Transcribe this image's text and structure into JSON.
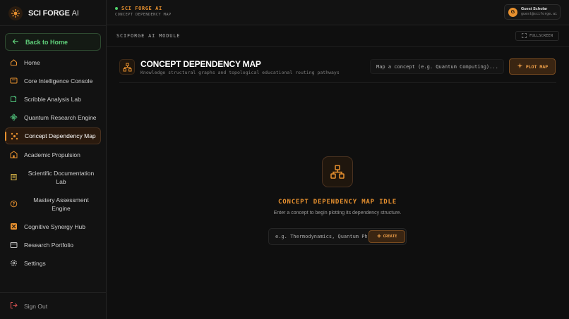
{
  "brand": {
    "name": "SCI FORGE",
    "suffix": "AI"
  },
  "sidebar": {
    "back_label": "Back to Home",
    "items": [
      {
        "label": "Home",
        "icon": "home-icon"
      },
      {
        "label": "Core Intelligence Console",
        "icon": "console-icon"
      },
      {
        "label": "Scribble Analysis Lab",
        "icon": "scribble-icon"
      },
      {
        "label": "Quantum Research Engine",
        "icon": "atom-icon"
      },
      {
        "label": "Concept Dependency Map",
        "icon": "network-icon",
        "active": true
      },
      {
        "label": "Academic Propulsion",
        "icon": "building-icon"
      },
      {
        "label": "Scientific Documentation Lab",
        "icon": "document-icon"
      },
      {
        "label": "Mastery Assessment Engine",
        "icon": "help-circle-icon"
      },
      {
        "label": "Cognitive Synergy Hub",
        "icon": "synergy-icon"
      },
      {
        "label": "Research Portfolio",
        "icon": "folder-icon"
      },
      {
        "label": "Settings",
        "icon": "gear-icon"
      }
    ],
    "signout_label": "Sign Out"
  },
  "topbar": {
    "title": "SCI FORGE AI",
    "subtitle": "CONCEPT DEPENDENCY MAP",
    "user": {
      "initial": "G",
      "name": "Guest Scholar",
      "email": "guest@sciforge.ai"
    }
  },
  "module": {
    "label": "SCIFORGE AI MODULE",
    "fullscreen_label": "FULLSCREEN"
  },
  "header": {
    "title": "CONCEPT DEPENDENCY MAP",
    "subtitle": "Knowledge structural graphs and topological educational routing pathways",
    "search_placeholder": "Map a concept (e.g. Quantum Computing)...",
    "plot_label": "PLOT MAP"
  },
  "idle": {
    "title": "CONCEPT DEPENDENCY MAP IDLE",
    "subtitle": "Enter a concept to begin plotting its dependency structure.",
    "input_placeholder": "e.g. Thermodynamics, Quantum Physics",
    "create_label": "CREATE"
  },
  "colors": {
    "accent": "#e8912f",
    "success": "#5fd07a",
    "background": "#0f0f0f"
  }
}
